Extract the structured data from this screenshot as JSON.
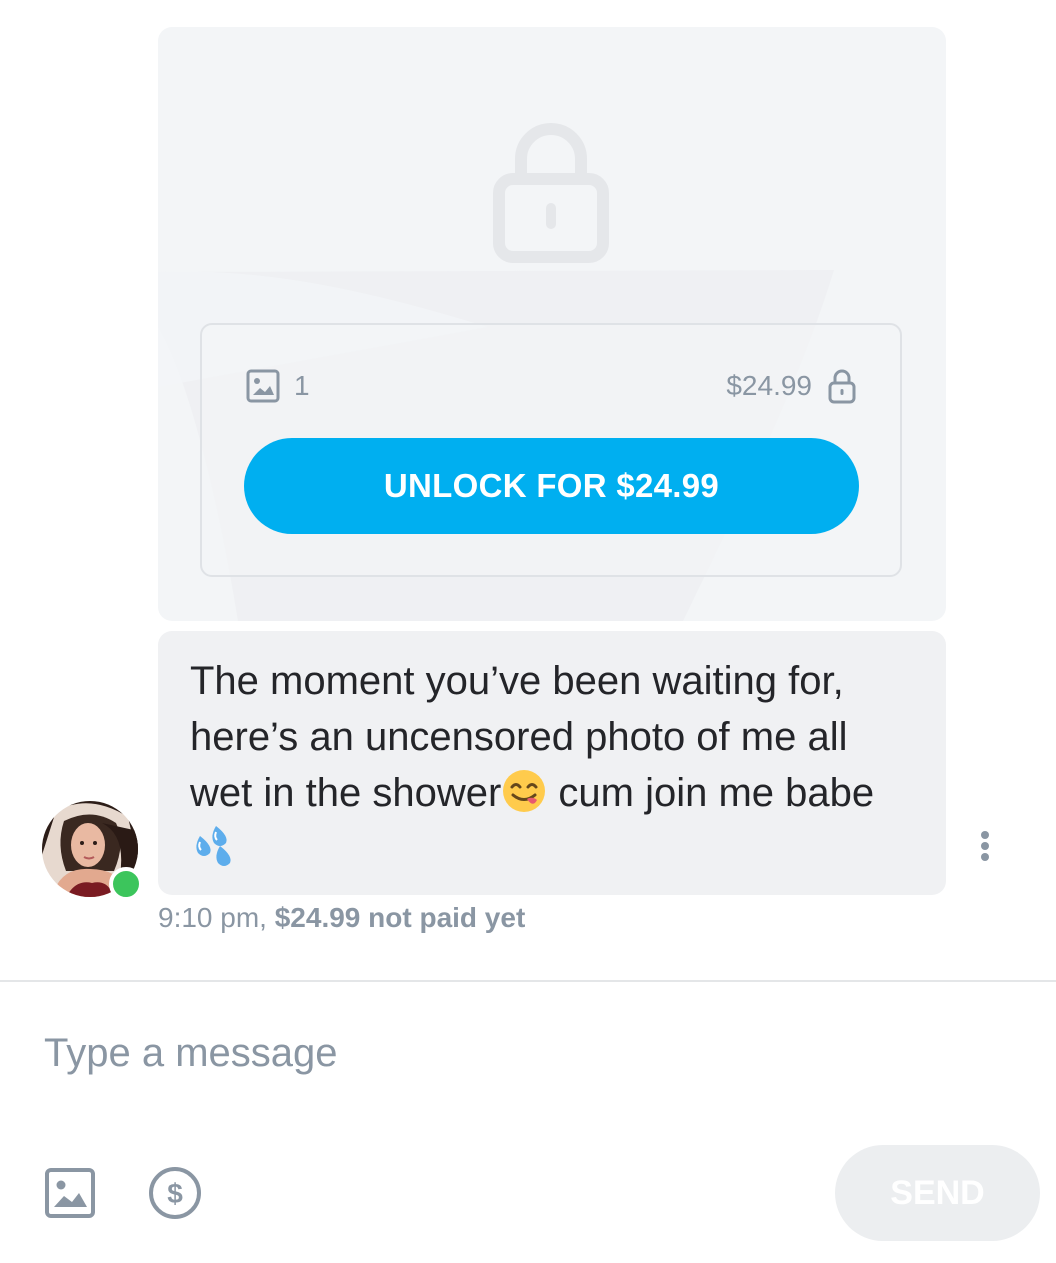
{
  "locked_media": {
    "media_icon": "image-icon",
    "media_count": "1",
    "price": "$24.99",
    "lock_icon": "lock-icon",
    "unlock_button_label": "UNLOCK FOR $24.99"
  },
  "message": {
    "text_before_emoji": "The moment you’ve been waiting for, here’s an uncensored photo of me all wet in the shower",
    "emoji_1": "yum-face-emoji",
    "text_after_emoji": " cum join me babe",
    "emoji_2": "sweat-droplets-emoji",
    "time": "9:10 pm,",
    "paid_status": "$24.99 not paid yet"
  },
  "sender": {
    "avatar": "avatar",
    "online": true,
    "online_color": "#3cc55c"
  },
  "composer": {
    "placeholder": "Type a message",
    "attach_icon": "image-icon",
    "tip_icon": "dollar-icon",
    "send_label": "SEND"
  },
  "colors": {
    "accent": "#00aff0",
    "muted_text": "#8a96a3",
    "bubble_bg": "#f0f1f3"
  }
}
